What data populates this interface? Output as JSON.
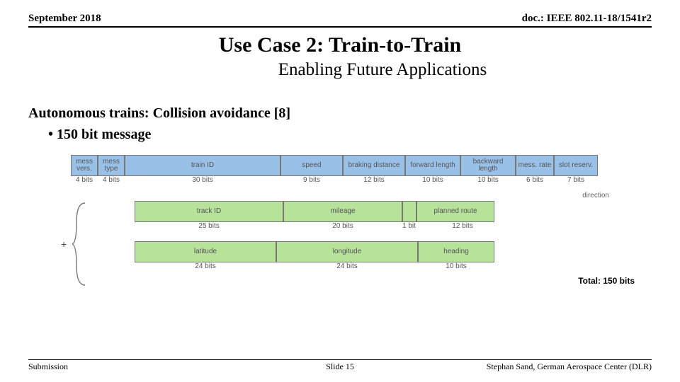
{
  "header": {
    "date": "September 2018",
    "doc": "doc.: IEEE 802.11-18/1541r2"
  },
  "title": "Use Case 2: Train-to-Train",
  "subtitle": "Enabling Future Applications",
  "body": {
    "heading": "Autonomous trains: Collision avoidance [8]",
    "bullet1": "• 150 bit message"
  },
  "row1": {
    "c0": {
      "label": "mess\nvers.",
      "bits": "4 bits"
    },
    "c1": {
      "label": "mess\ntype",
      "bits": "4 bits"
    },
    "c2": {
      "label": "train ID",
      "bits": "30 bits"
    },
    "c3": {
      "label": "speed",
      "bits": "9 bits"
    },
    "c4": {
      "label": "braking\ndistance",
      "bits": "12 bits"
    },
    "c5": {
      "label": "forward\nlength",
      "bits": "10 bits"
    },
    "c6": {
      "label": "backward\nlength",
      "bits": "10 bits"
    },
    "c7": {
      "label": "mess.\nrate",
      "bits": "6 bits"
    },
    "c8": {
      "label": "slot\nreserv.",
      "bits": "7 bits"
    }
  },
  "dir_label": "direction",
  "row2": {
    "c0": {
      "label": "track ID",
      "bits": "25 bits"
    },
    "c1": {
      "label": "mileage",
      "bits": "20 bits"
    },
    "c2": {
      "label": "",
      "bits": "1 bit"
    },
    "c3": {
      "label": "planned route",
      "bits": "12 bits"
    }
  },
  "row3": {
    "c0": {
      "label": "latitude",
      "bits": "24 bits"
    },
    "c1": {
      "label": "longitude",
      "bits": "24 bits"
    },
    "c2": {
      "label": "heading",
      "bits": "10 bits"
    }
  },
  "plus": "+",
  "total": "Total: 150 bits",
  "footer": {
    "left": "Submission",
    "center": "Slide 15",
    "right": "Stephan Sand, German Aerospace Center (DLR)"
  }
}
